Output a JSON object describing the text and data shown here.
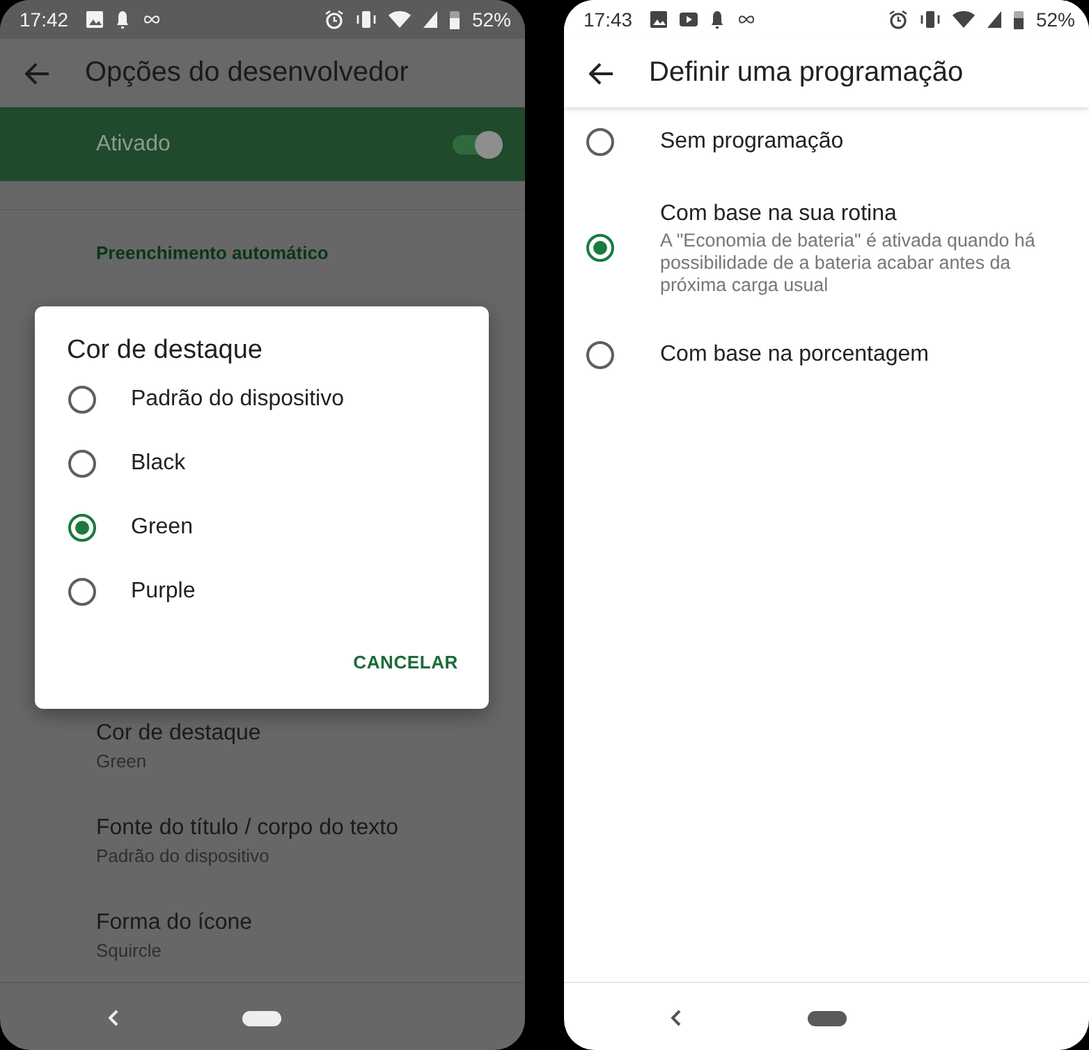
{
  "developer_options": {
    "status_bar": {
      "time": "17:42",
      "battery": "52%"
    },
    "app_bar": {
      "title": "Opções do desenvolvedor"
    },
    "master_switch": {
      "label": "Ativado",
      "on": true
    },
    "section_header": "Preenchimento automático",
    "settings": [
      {
        "title": "Cor de destaque",
        "summary": "Green"
      },
      {
        "title": "Fonte do título / corpo do texto",
        "summary": "Padrão do dispositivo"
      },
      {
        "title": "Forma do ícone",
        "summary": "Squircle"
      }
    ],
    "dialog": {
      "title": "Cor de destaque",
      "options": [
        {
          "label": "Padrão do dispositivo",
          "selected": false
        },
        {
          "label": "Black",
          "selected": false
        },
        {
          "label": "Green",
          "selected": true
        },
        {
          "label": "Purple",
          "selected": false
        }
      ],
      "button": "CANCELAR"
    }
  },
  "battery_schedule": {
    "status_bar": {
      "time": "17:43",
      "battery": "52%"
    },
    "app_bar": {
      "title": "Definir uma programação"
    },
    "options": [
      {
        "title": "Sem programação",
        "selected": false
      },
      {
        "title": "Com base na sua rotina",
        "description": "A \"Economia de bateria\" é ativada quando há possibilidade de a bateria acabar antes da próxima carga usual",
        "selected": true
      },
      {
        "title": "Com base na porcentagem",
        "selected": false
      }
    ]
  }
}
